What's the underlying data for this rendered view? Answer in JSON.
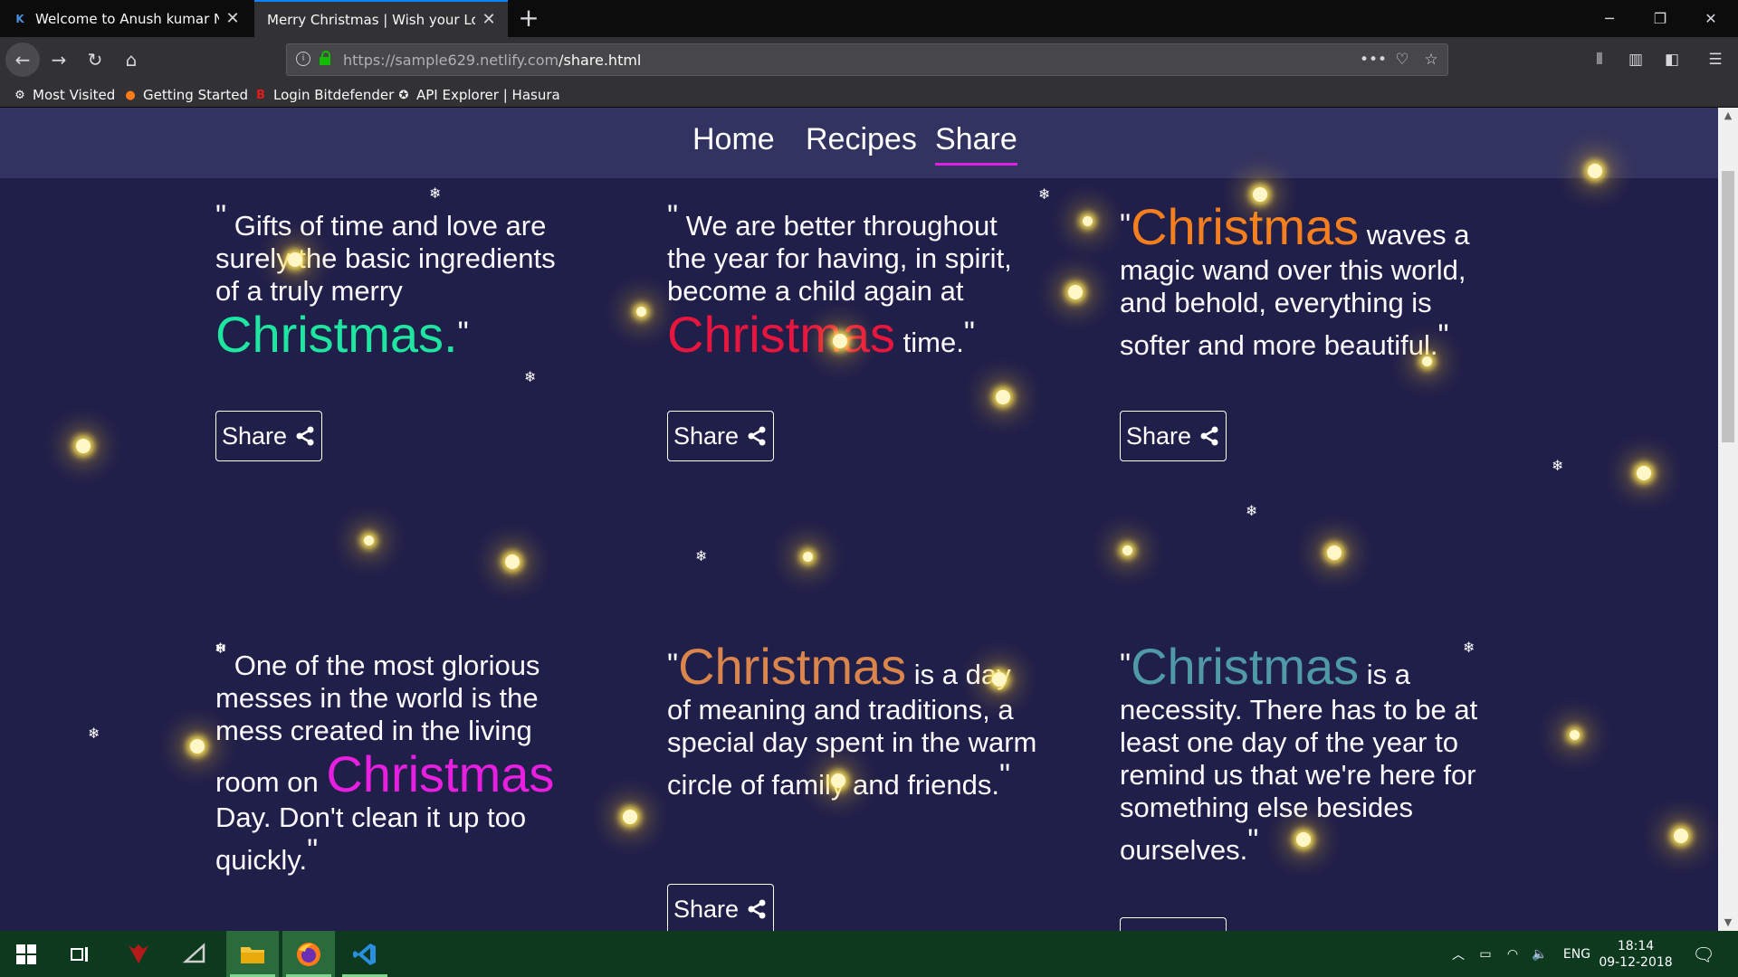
{
  "browser": {
    "tabs": [
      {
        "title": "Welcome to Anush kumar N's p",
        "favicon": "K"
      },
      {
        "title": "Merry Christmas | Wish your Loved"
      }
    ],
    "url_host": "https://sample629.netlify.com",
    "url_path": "/share.html",
    "bookmarks": [
      "Most Visited",
      "Getting Started",
      "Login Bitdefender",
      "API Explorer | Hasura"
    ]
  },
  "site_nav": [
    "Home",
    "Recipes",
    "Share"
  ],
  "active_nav": "Share",
  "quotes": [
    {
      "before": "Gifts of time and love are surely the basic ingredients of a truly merry",
      "highlight": "Christmas.",
      "after": "",
      "color": "#1ee5a0"
    },
    {
      "before": "We are better throughout the year for having, in spirit, become a child again at",
      "highlight": "Christmas",
      "after": "time.",
      "color": "#e8153e"
    },
    {
      "before": "",
      "highlight": "Christmas",
      "after": "waves a magic wand over this world, and behold, everything is softer and more beautiful.",
      "color": "#f57f1e"
    },
    {
      "before": "One of the most glorious messes in the world is the mess created in the living room on",
      "highlight": "Christmas",
      "after": "Day. Don't clean it up too quickly.",
      "color": "#e81ee0"
    },
    {
      "before": "",
      "highlight": "Christmas",
      "after": "is a day of meaning and traditions, a special day spent in the warm circle of family and friends.",
      "color": "#d9854b"
    },
    {
      "before": "",
      "highlight": "Christmas",
      "after": "is a necessity. There has to be at least one day of the year to remind us that we're here for something else besides ourselves.",
      "color": "#4f9aa6"
    }
  ],
  "share_label": "Share",
  "quote_mark": "\"",
  "taskbar": {
    "lang": "ENG",
    "time": "18:14",
    "date": "09-12-2018"
  },
  "colors": {
    "page_bg": "#201f4a",
    "nav_bg": "#333361",
    "active_underline": "#e020e0",
    "taskbar_bg": "#0d3a1f"
  }
}
